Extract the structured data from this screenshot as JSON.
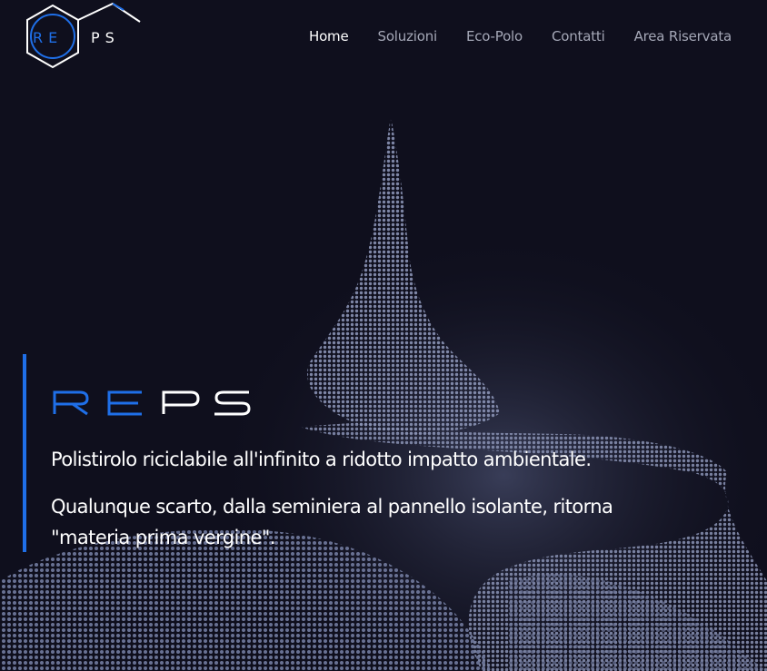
{
  "brand": {
    "logo_letters": "RE PS",
    "hero_wordmark": "REPS",
    "accent_color": "#1f6fe8"
  },
  "nav": {
    "items": [
      "Home",
      "Soluzioni",
      "Eco-Polo",
      "Contatti",
      "Area Riservata"
    ],
    "active": "Home"
  },
  "hero": {
    "tagline": "Polistirolo riciclabile all'infinito a ridotto impatto ambientale.",
    "description": "Qualunque scarto, dalla seminiera al pannello isolante, ritorna \"materia prima vergine\"."
  },
  "colors": {
    "background": "#0f0f1d",
    "particles": "#8a93b5",
    "nav_text": "#a4a7b6"
  }
}
